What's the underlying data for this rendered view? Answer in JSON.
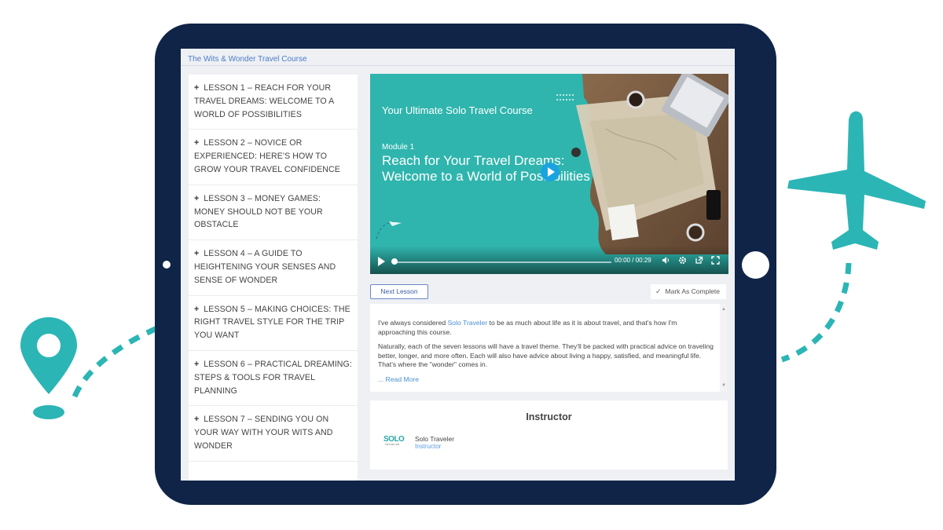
{
  "course": {
    "title": "The Wits & Wonder Travel Course"
  },
  "lessons": [
    {
      "label": "LESSON 1 – REACH FOR YOUR TRAVEL DREAMS: WELCOME TO A WORLD OF POSSIBILITIES"
    },
    {
      "label": "LESSON 2 – NOVICE OR EXPERIENCED: HERE'S HOW TO GROW YOUR TRAVEL CONFIDENCE"
    },
    {
      "label": "LESSON 3 – MONEY GAMES: MONEY SHOULD NOT BE YOUR OBSTACLE"
    },
    {
      "label": "LESSON 4 – A GUIDE TO HEIGHTENING YOUR SENSES AND SENSE OF WONDER"
    },
    {
      "label": "LESSON 5 – MAKING CHOICES: THE RIGHT TRAVEL STYLE FOR THE TRIP YOU WANT"
    },
    {
      "label": "LESSON 6 – PRACTICAL DREAMING: STEPS & TOOLS FOR TRAVEL PLANNING"
    },
    {
      "label": "LESSON 7 – SENDING YOU ON YOUR WAY WITH YOUR WITS AND WONDER"
    }
  ],
  "video": {
    "subtitle": "Your Ultimate Solo Travel Course",
    "module": "Module 1",
    "title": "Reach for Your Travel Dreams: Welcome to a World of Possibilities",
    "time_current": "00:00",
    "time_separator": "/",
    "time_total": "00:29",
    "progress": 0
  },
  "actions": {
    "next_lesson": "Next Lesson",
    "mark_complete": "Mark As Complete"
  },
  "description": {
    "p1_before": "I've always considered ",
    "p1_link": "Solo Traveler",
    "p1_after": " to be as much about life as it is about travel, and that's how I'm approaching this course.",
    "p2": "Naturally, each of the seven lessons will have a travel theme. They'll be packed with practical advice on traveling better, longer, and more often. Each will also have advice about living a happy, satisfied, and meaningful life. That's where the \"wonder\" comes in.",
    "read_more": "... Read More"
  },
  "instructor": {
    "heading": "Instructor",
    "logo_text": "SOLO",
    "logo_sub": "TRAVELER",
    "name": "Solo Traveler",
    "role": "Instructor"
  },
  "colors": {
    "tablet_frame": "#0f2447",
    "accent_teal": "#2cb5b5",
    "link_blue": "#4a8fd1"
  },
  "icons": [
    "location-pin-icon",
    "airplane-icon",
    "play-icon",
    "volume-icon",
    "settings-icon",
    "external-link-icon",
    "fullscreen-icon",
    "checkmark-icon",
    "plus-icon",
    "paper-plane-icon"
  ]
}
